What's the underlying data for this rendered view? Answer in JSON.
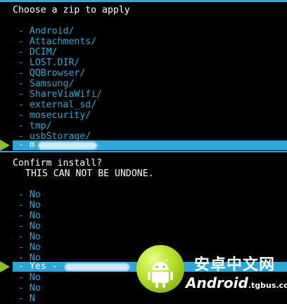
{
  "apply_zip": {
    "title": "Choose a zip to apply",
    "folders": [
      "- Android/",
      "- Attachments/",
      "- DCIM/",
      "- LOST.DIR/",
      "- QQBrowser/",
      "- Samsung/",
      "- ShareViaWifi/",
      "- external_sd/",
      "- mosecurity/",
      "- tmp/",
      "- usbStorage/"
    ],
    "selected_item": "- m"
  },
  "confirm": {
    "title": "Confirm install?",
    "warning": "THIS CAN NOT BE UNDONE.",
    "options_before": [
      "- No",
      "- No",
      "- No",
      "- No",
      "- No",
      "- No",
      "- No"
    ],
    "selected_option": "- Yes -",
    "options_after": [
      "- No",
      "- No",
      "- N"
    ]
  },
  "watermark": {
    "cn": "安卓中文网",
    "brand": "Android",
    "domain": ".tgbus.com"
  },
  "colors": {
    "accent": "#2ea7d8",
    "arrow": "#8cbe2c",
    "background": "#000000"
  }
}
